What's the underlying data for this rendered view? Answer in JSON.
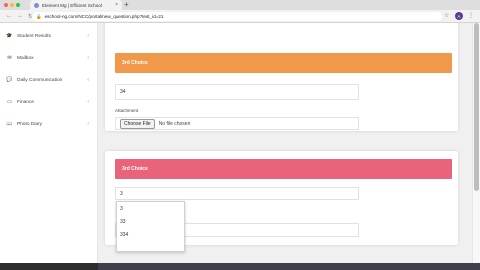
{
  "browser": {
    "tab_title": "Element Mg | Efficient School",
    "url": "eschool-ng.com/NCC/portal/new_question.php?test_id=21",
    "profile_initial": "A"
  },
  "sidebar": {
    "items": [
      {
        "label": "Student Results",
        "icon": "graduation-cap-icon"
      },
      {
        "label": "Mailbox",
        "icon": "mail-icon"
      },
      {
        "label": "Daily Communication",
        "icon": "chat-icon"
      },
      {
        "label": "Finance",
        "icon": "money-icon"
      },
      {
        "label": "Photo Diary",
        "icon": "book-icon"
      }
    ]
  },
  "choices": {
    "third_a": {
      "header": "3rd Choice",
      "answer_value": "34",
      "attachment_label": "Attachment",
      "choose_button": "Choose File",
      "no_file": "No file chosen",
      "color": "#f0994a"
    },
    "third_b": {
      "header": "3rd Choice",
      "answer_value": "3",
      "color": "#e9647a",
      "visible_field_tail": "n"
    }
  },
  "autocomplete": {
    "options": [
      "3",
      "33",
      "334"
    ]
  }
}
